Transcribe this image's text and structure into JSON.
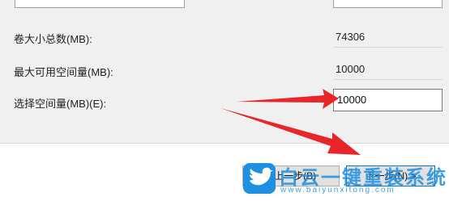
{
  "dialog": {
    "rows": [
      {
        "label": "卷大小总数(MB):",
        "value": "74306"
      },
      {
        "label": "最大可用空间量(MB):",
        "value": "10000"
      },
      {
        "label": "选择空间量(MB)(E):",
        "value": "10000"
      }
    ]
  },
  "footer": {
    "back_label": "< 上一步(B)",
    "next_label": "下一步(N) >"
  },
  "annotation": {
    "arrow_color": "#e8262a"
  },
  "watermark": {
    "brand": "白云一键重装系统",
    "url": "www.baiyunxitong.com",
    "color": "#1e8fe1"
  }
}
